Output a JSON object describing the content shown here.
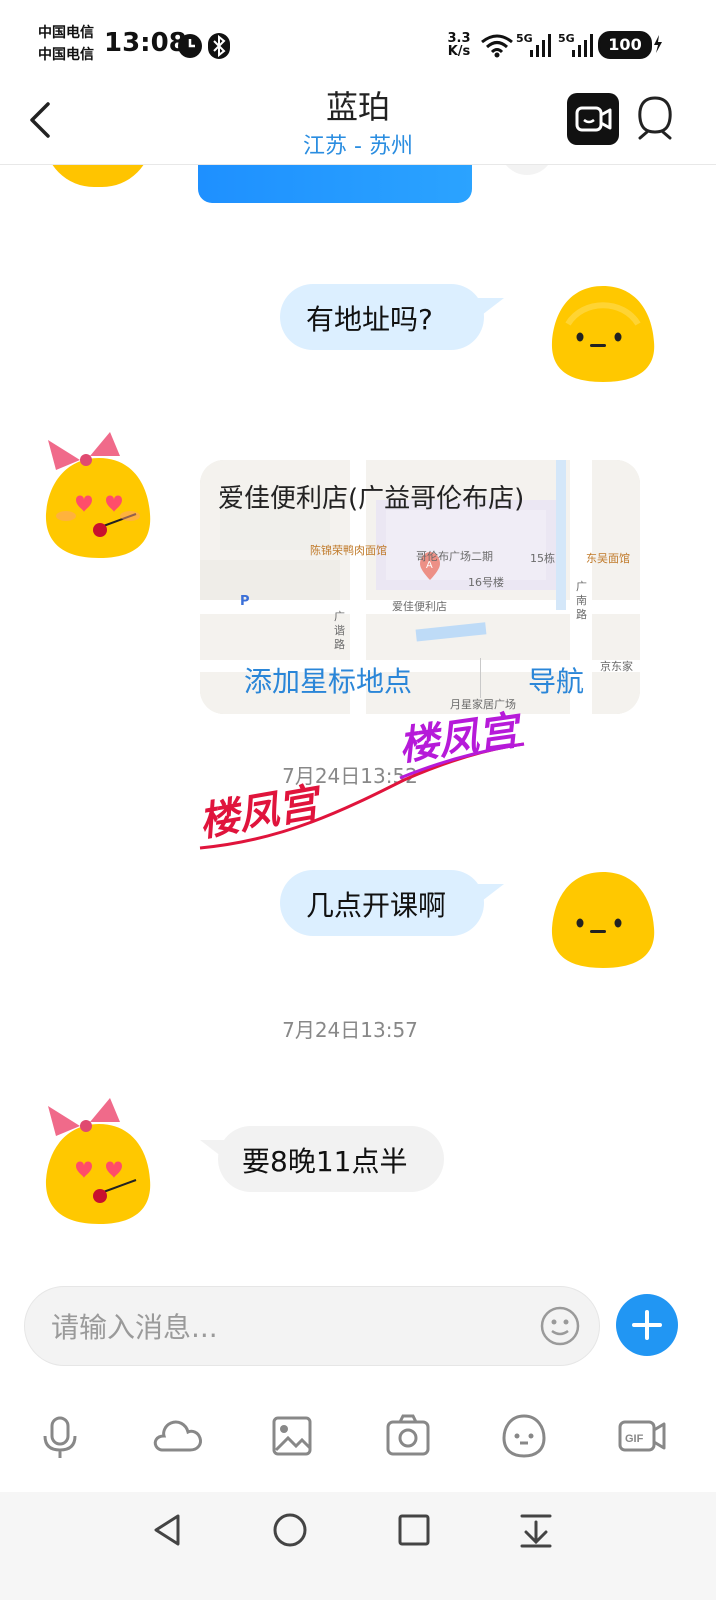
{
  "status_bar": {
    "carrier_1": "中国电信",
    "carrier_2": "中国电信",
    "time": "13:08",
    "speed_value": "3.3",
    "speed_unit": "K/s",
    "net_1": "5G",
    "net_2": "5G",
    "battery": "100"
  },
  "header": {
    "title": "蓝珀",
    "subtitle": "江苏 - 苏州"
  },
  "messages": {
    "m1": {
      "text": "有地址吗?"
    },
    "map": {
      "place_name": "爱佳便利店(广益哥伦布店)",
      "add_star_label": "添加星标地点",
      "navigate_label": "导航",
      "labels": [
        "哥伦布广场二期",
        "陈锦荣鸭肉面馆",
        "东吴面馆",
        "爱佳便利店",
        "16号楼",
        "15栋",
        "广谐路",
        "广南路",
        "月星家居广场",
        "京东家",
        "P"
      ]
    },
    "ts1": "7月24日13:52",
    "watermark": {
      "text_1": "楼凤宫",
      "text_2": "楼凤宫"
    },
    "m2": {
      "text": "几点开课啊"
    },
    "ts2": "7月24日13:57",
    "m3": {
      "text": "要8晚11点半"
    }
  },
  "composer": {
    "placeholder": "请输入消息..."
  },
  "toolbar_icons": [
    "mic-icon",
    "cloud-icon",
    "image-icon",
    "camera-icon",
    "emoji-icon",
    "gif-icon"
  ],
  "colors": {
    "accent": "#2a8de0",
    "bubble_me": "#dcefff",
    "bubble_them": "#f2f2f2",
    "plus_button": "#2196f3",
    "watermark_red": "#e0143c",
    "watermark_purple": "#b61ad9"
  }
}
